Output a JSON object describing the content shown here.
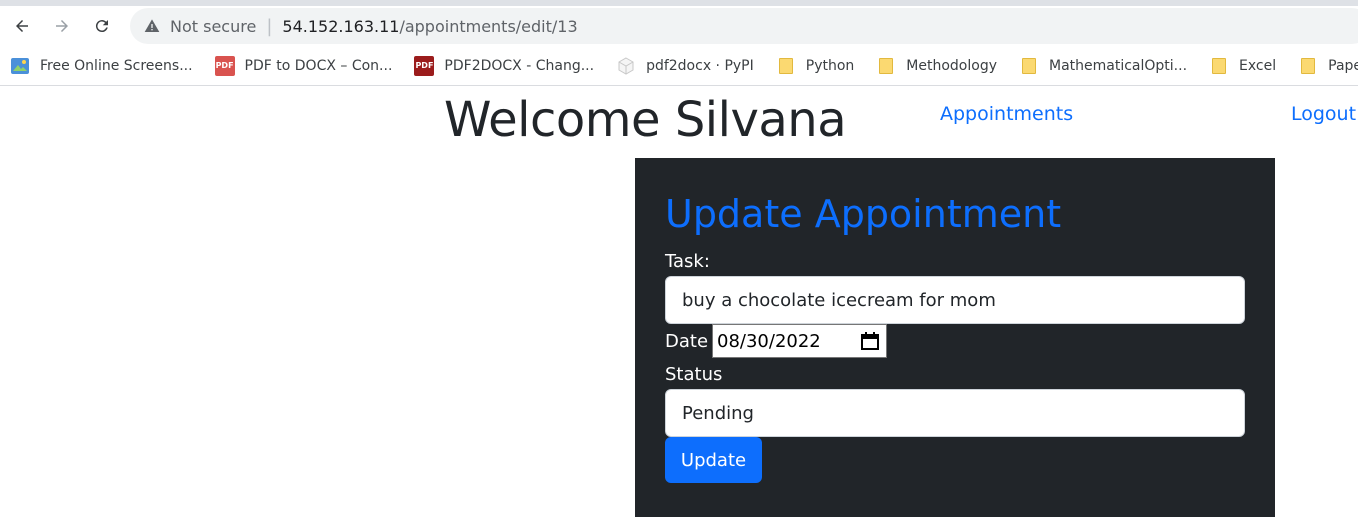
{
  "browser": {
    "security_label": "Not secure",
    "url_host": "54.152.163.11",
    "url_path": "/appointments/edit/13"
  },
  "bookmarks": [
    {
      "label": "Free Online Screens...",
      "icon": "screenshot-app-icon"
    },
    {
      "label": "PDF to DOCX – Con...",
      "icon": "pdf-icon"
    },
    {
      "label": "PDF2DOCX - Chang...",
      "icon": "pdf-icon"
    },
    {
      "label": "pdf2docx · PyPI",
      "icon": "pypi-cube-icon"
    },
    {
      "label": "Python",
      "icon": "folder-icon"
    },
    {
      "label": "Methodology",
      "icon": "folder-icon"
    },
    {
      "label": "MathematicalOpti...",
      "icon": "folder-icon"
    },
    {
      "label": "Excel",
      "icon": "folder-icon"
    },
    {
      "label": "Papers",
      "icon": "folder-icon"
    }
  ],
  "header": {
    "welcome": "Welcome Silvana",
    "nav_appointments": "Appointments",
    "nav_logout": "Logout"
  },
  "form": {
    "title": "Update Appointment",
    "task_label": "Task:",
    "task_value": "buy a chocolate icecream for mom",
    "date_label": "Date",
    "date_value": "08/30/2022",
    "status_label": "Status",
    "status_value": "Pending",
    "submit_label": "Update"
  },
  "colors": {
    "accent": "#0d6efd",
    "panel_bg": "#212529"
  }
}
